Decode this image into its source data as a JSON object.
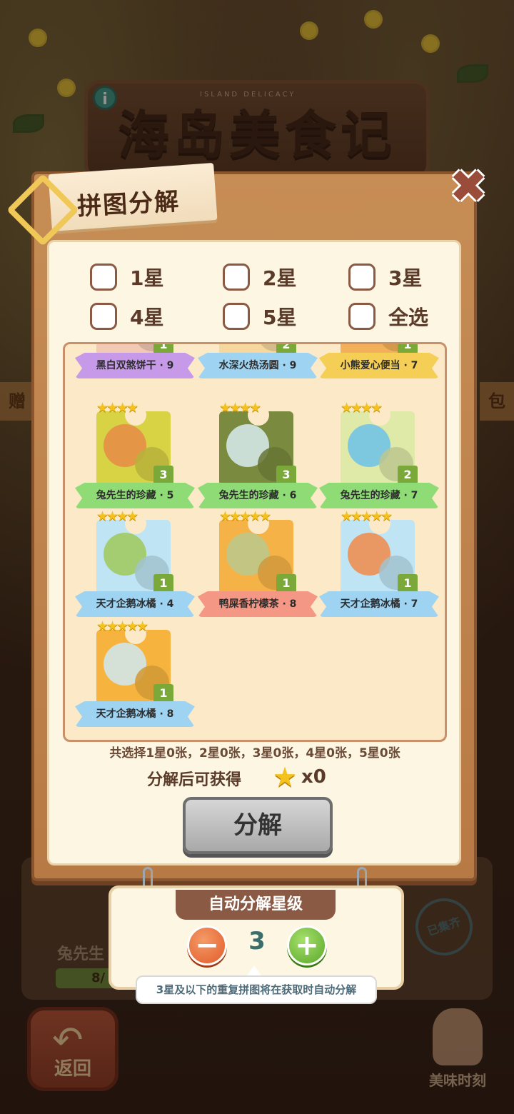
{
  "background": {
    "subtitle": "ISLAND DELICACY",
    "title": "海岛美食记",
    "info_icon": "i",
    "side_left": "赠",
    "side_right": "包",
    "card_name": "兔先生",
    "card_progress": "8/",
    "stamp": "已集齐",
    "back_label": "返回",
    "moment_label": "美味时刻"
  },
  "dialog": {
    "title": "拼图分解",
    "close_icon": "✖",
    "filters": [
      "1星",
      "2星",
      "3星",
      "4星",
      "5星",
      "全选"
    ],
    "cards": [
      {
        "name": "黑白双煞饼干 · 9",
        "stars": "",
        "count": "1",
        "color": "b-purple",
        "art1": "#f2c9b5",
        "art2": "#f6b6c9"
      },
      {
        "name": "水深火热汤圆 · 9",
        "stars": "",
        "count": "2",
        "color": "b-blue",
        "art1": "#f6d89e",
        "art2": "#f0a76a"
      },
      {
        "name": "小熊爱心便当 · 7",
        "stars": "",
        "count": "1",
        "color": "b-yellow",
        "art1": "#f2b05a",
        "art2": "#f6d27b"
      },
      {
        "name": "兔先生的珍藏 · 5",
        "stars": "★★★★",
        "count": "3",
        "color": "b-green",
        "art1": "#d8d245",
        "art2": "#e88b46"
      },
      {
        "name": "兔先生的珍藏 · 6",
        "stars": "★★★★",
        "count": "3",
        "color": "b-green",
        "art1": "#7a8a3e",
        "art2": "#d8ecf0"
      },
      {
        "name": "兔先生的珍藏 · 7",
        "stars": "★★★★",
        "count": "2",
        "color": "b-green",
        "art1": "#dfeaa8",
        "art2": "#6cc2e8"
      },
      {
        "name": "天才企鹅冰橘 · 4",
        "stars": "★★★★",
        "count": "1",
        "color": "b-blue",
        "art1": "#bfe5f4",
        "art2": "#9fc95a"
      },
      {
        "name": "鸭屎香柠檬茶 · 8",
        "stars": "★★★★★",
        "count": "1",
        "color": "b-red",
        "art1": "#f5b347",
        "art2": "#b9c98d"
      },
      {
        "name": "天才企鹅冰橘 · 7",
        "stars": "★★★★★",
        "count": "1",
        "color": "b-blue",
        "art1": "#bfe5f4",
        "art2": "#f08b4a"
      },
      {
        "name": "天才企鹅冰橘 · 8",
        "stars": "★★★★★",
        "count": "1",
        "color": "b-blue",
        "art1": "#f6b33e",
        "art2": "#cfe7f2"
      }
    ],
    "summary": "共选择1星0张，2星0张，3星0张，4星0张，5星0张",
    "reward_label": "分解后可获得",
    "reward_icon": "★",
    "reward_count": "x0",
    "decompose_label": "分解"
  },
  "auto": {
    "title": "自动分解星级",
    "minus": "−",
    "plus": "+",
    "level": "3",
    "tooltip": "3星及以下的重复拼图将在获取时自动分解"
  }
}
